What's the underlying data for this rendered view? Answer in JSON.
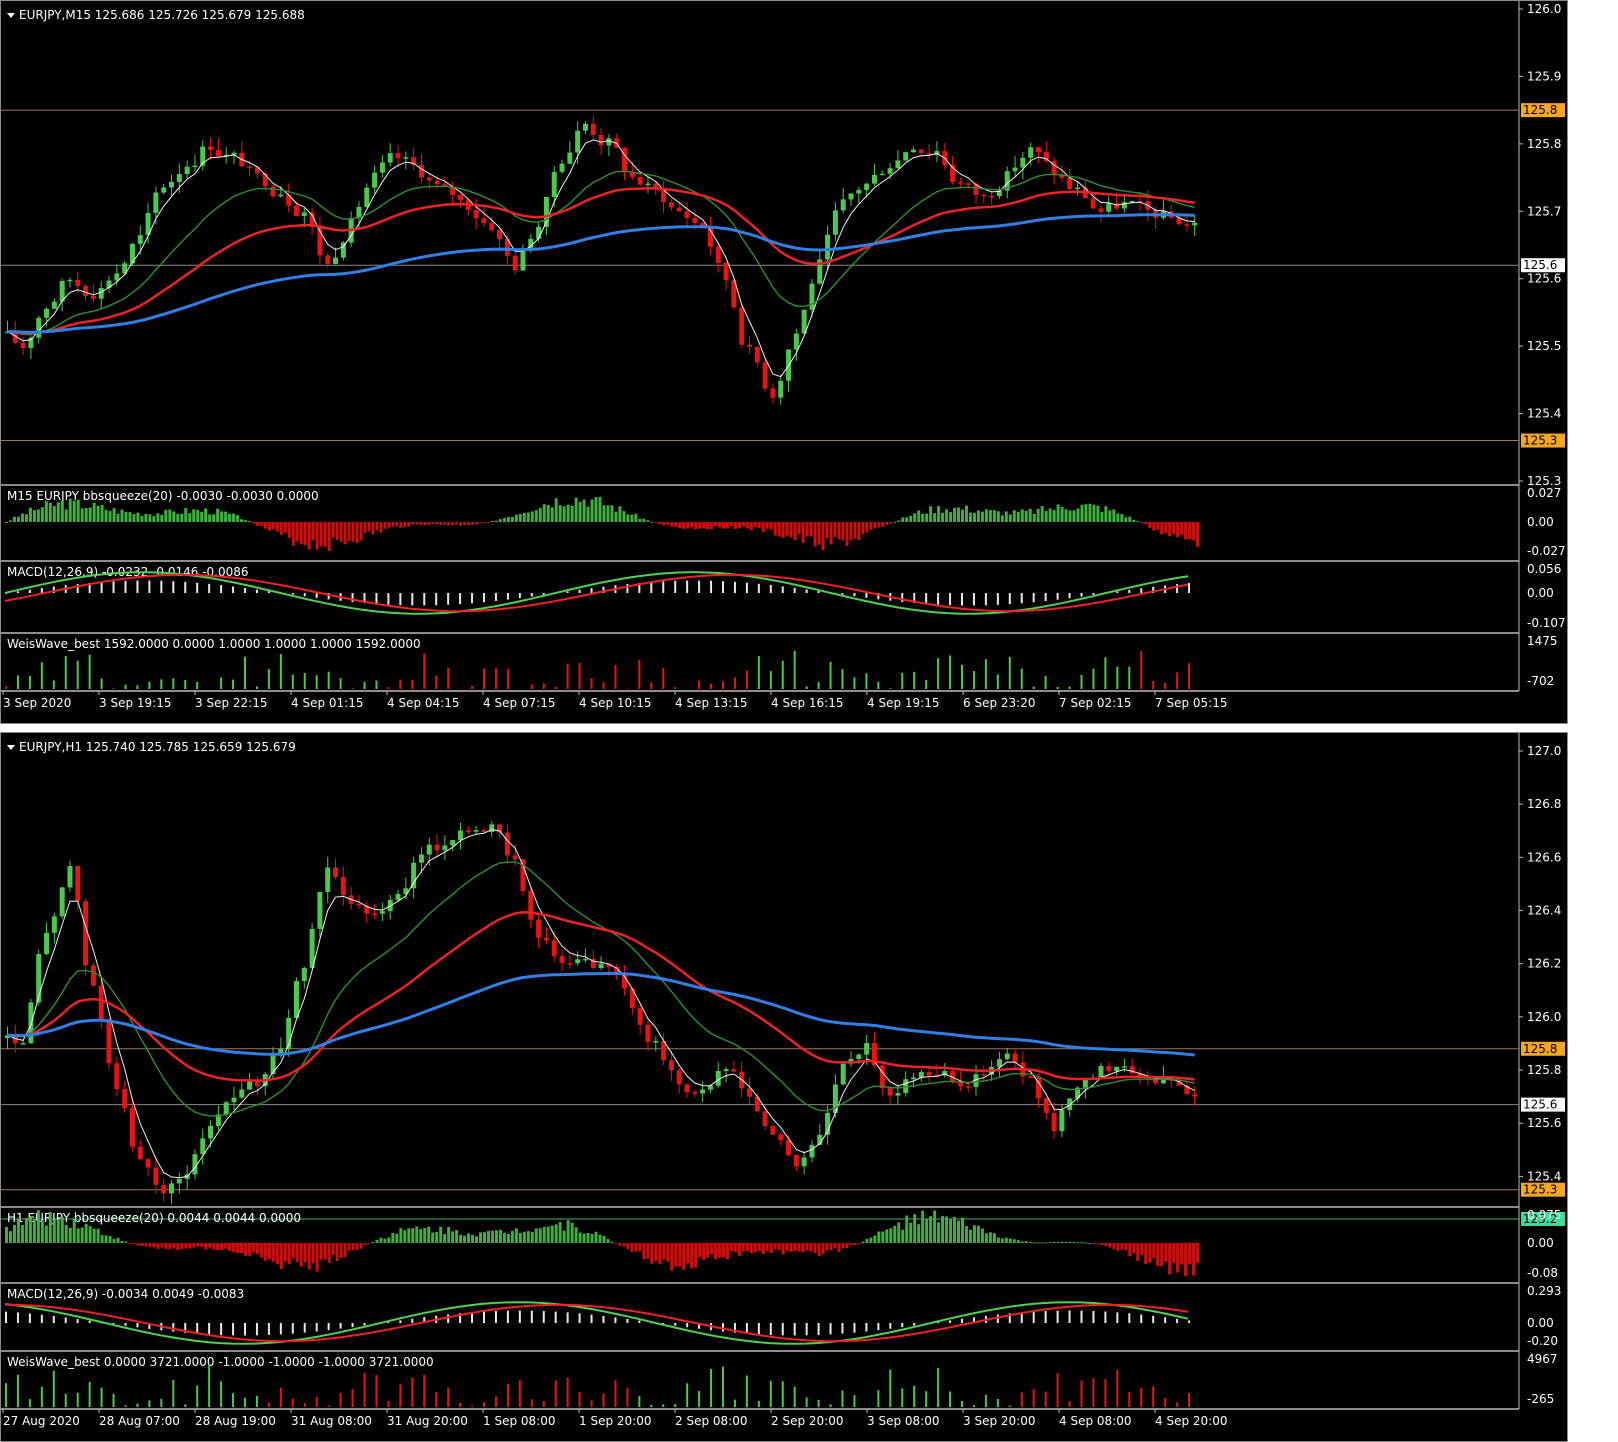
{
  "colors": {
    "bull": "#4cc94c",
    "bear": "#e81414",
    "ma_white": "#f0f0f0",
    "ma_green": "#2f8f2f",
    "ma_red": "#ee2222",
    "ma_blue": "#2f7fe6",
    "grid_line": "#9a7a5a",
    "tag_orange": "#f5a623",
    "tag_green": "#3cdd9c",
    "squeeze_bull": "#3faf3f",
    "squeeze_bear": "#c81010",
    "macd_hist": "#e8e8e8"
  },
  "chart_data": [
    {
      "type": "candlestick",
      "symbol": "EURJPY,M15",
      "header": "EURJPY,M15  125.686 125.726 125.679 125.688",
      "ylim": [
        125.3,
        126.0
      ],
      "y_ticks": [
        "126.0",
        "125.9",
        "125.8",
        "125.7",
        "125.6",
        "125.5",
        "125.4",
        "125.3"
      ],
      "x_ticks": [
        "3 Sep 2020",
        "3 Sep 19:15",
        "3 Sep 22:15",
        "4 Sep 01:15",
        "4 Sep 04:15",
        "4 Sep 07:15",
        "4 Sep 10:15",
        "4 Sep 13:15",
        "4 Sep 16:15",
        "4 Sep 19:15",
        "6 Sep 23:20",
        "7 Sep 02:15",
        "7 Sep 05:15"
      ],
      "price_levels": [
        {
          "value": 125.85,
          "label": "125.8",
          "color": "orange"
        },
        {
          "value": 125.62,
          "label": "125.6",
          "color": "white"
        },
        {
          "value": 125.36,
          "label": "125.3",
          "color": "orange"
        }
      ],
      "candles_close": [
        125.5,
        125.56,
        125.6,
        125.58,
        125.61,
        125.66,
        125.74,
        125.77,
        125.8,
        125.78,
        125.75,
        125.73,
        125.7,
        125.62,
        125.68,
        125.75,
        125.78,
        125.76,
        125.73,
        125.71,
        125.68,
        125.62,
        125.68,
        125.78,
        125.83,
        125.8,
        125.75,
        125.73,
        125.7,
        125.68,
        125.6,
        125.49,
        125.43,
        125.52,
        125.62,
        125.71,
        125.74,
        125.77,
        125.8,
        125.79,
        125.74,
        125.72,
        125.75,
        125.79,
        125.76,
        125.73,
        125.7,
        125.71,
        125.7,
        125.69,
        125.68
      ],
      "indicators": [
        {
          "label": "M15 EURJPY bbsqueeze(20) -0.0030 -0.0030 0.0000",
          "ticks": [
            "0.027",
            "0.00",
            "-0.027"
          ]
        },
        {
          "label": "MACD(12,26,9) -0.0232 -0.0146 -0.0086",
          "ticks": [
            "0.056",
            "0.00",
            "-0.107"
          ]
        },
        {
          "label": "WeisWave_best 1592.0000 0.0000 1.0000 1.0000 1.0000 1592.0000",
          "ticks": [
            "1475",
            "-702"
          ]
        }
      ]
    },
    {
      "type": "candlestick",
      "symbol": "EURJPY,H1",
      "header": "EURJPY,H1  125.740 125.785 125.659 125.679",
      "ylim": [
        125.3,
        127.0
      ],
      "y_ticks": [
        "127.0",
        "126.8",
        "126.6",
        "126.4",
        "126.2",
        "126.0",
        "125.8",
        "125.6",
        "125.4"
      ],
      "x_ticks": [
        "27 Aug 2020",
        "28 Aug 07:00",
        "28 Aug 19:00",
        "31 Aug 08:00",
        "31 Aug 20:00",
        "1 Sep 08:00",
        "1 Sep 20:00",
        "2 Sep 08:00",
        "2 Sep 20:00",
        "3 Sep 08:00",
        "3 Sep 20:00",
        "4 Sep 08:00",
        "4 Sep 20:00"
      ],
      "price_levels": [
        {
          "value": 125.88,
          "label": "125.8",
          "color": "orange"
        },
        {
          "value": 125.67,
          "label": "125.6",
          "color": "white"
        },
        {
          "value": 125.35,
          "label": "125.3",
          "color": "orange"
        },
        {
          "value": 125.24,
          "label": "125.2",
          "color": "green"
        }
      ],
      "candles_close": [
        125.9,
        126.3,
        126.55,
        126.1,
        125.75,
        125.45,
        125.35,
        125.4,
        125.6,
        125.7,
        125.75,
        125.9,
        126.2,
        126.55,
        126.45,
        126.4,
        126.45,
        126.6,
        126.65,
        126.72,
        126.7,
        126.6,
        126.3,
        126.2,
        126.2,
        126.18,
        126.05,
        125.9,
        125.75,
        125.72,
        125.8,
        125.7,
        125.55,
        125.45,
        125.55,
        125.8,
        125.9,
        125.7,
        125.78,
        125.8,
        125.76,
        125.78,
        125.85,
        125.75,
        125.58,
        125.75,
        125.8,
        125.82,
        125.78,
        125.76,
        125.7
      ],
      "indicators": [
        {
          "label": "H1 EURJPY bbsqueeze(20) 0.0044 0.0044 0.0000",
          "ticks": [
            "0.075",
            "0.00",
            "-0.08"
          ]
        },
        {
          "label": "MACD(12,26,9) -0.0034 0.0049 -0.0083",
          "ticks": [
            "0.293",
            "0.00",
            "-0.20"
          ]
        },
        {
          "label": "WeisWave_best 0.0000 3721.0000 -1.0000 -1.0000 -1.0000 3721.0000",
          "ticks": [
            "4967",
            "-265"
          ]
        }
      ]
    }
  ]
}
